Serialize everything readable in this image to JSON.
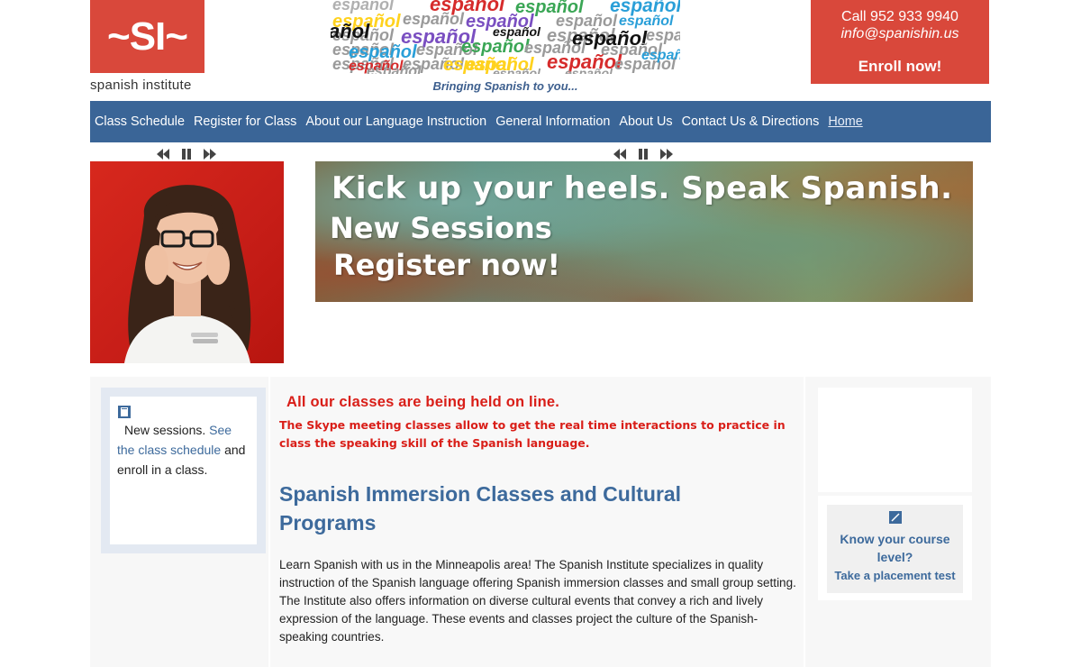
{
  "header": {
    "logo": {
      "mark": "~SI~",
      "name": "spanish institute",
      "color": "#d9483b"
    },
    "collage_words": [
      "español",
      "español",
      "español",
      "español",
      "español",
      "español",
      "español",
      "español",
      "español",
      "español",
      "español",
      "español",
      "español",
      "español",
      "español",
      "español",
      "español",
      "español",
      "español",
      "español",
      "español",
      "español",
      "español",
      "español",
      "español",
      "español",
      "español",
      "español",
      "español",
      "español",
      "español",
      "español",
      "añol"
    ],
    "tagline": "Bringing Spanish to you...",
    "contact": {
      "phone": "Call 952 933 9940",
      "email": "info@spanishin.us",
      "enroll": "Enroll now!",
      "color": "#d9483b"
    }
  },
  "nav": {
    "color": "#3a6597",
    "items": [
      {
        "label": "Class Schedule"
      },
      {
        "label": "Register for Class"
      },
      {
        "label": "About our Language Instruction"
      },
      {
        "label": "General Information"
      },
      {
        "label": "About Us"
      },
      {
        "label": "Contact Us & Directions"
      },
      {
        "label": "Home"
      }
    ]
  },
  "slider_controls": [
    "rewind-icon",
    "pause-icon",
    "fast-forward-icon"
  ],
  "banner": {
    "line1": "Kick up your heels. Speak Spanish.",
    "line2": "New Sessions",
    "line3": "Register now!"
  },
  "sidebar_left": {
    "text_before": "New sessions.",
    "link": "See the class schedule",
    "text_after": "and enroll in a class."
  },
  "main": {
    "alert_title": "All our classes are being held on line.",
    "alert_text": "The Skype meeting classes allow to get the real time interactions to practice in class the speaking skill of the Spanish language.",
    "heading": "Spanish Immersion Classes and Cultural Programs",
    "paragraph": "Learn Spanish with us in the Minneapolis area! The Spanish Institute specializes in quality instruction of the Spanish language offering Spanish immersion classes and small group setting. The Institute also offers information on diverse cultural events that convey a rich and lively expression of the language. These events and classes project the culture of the Spanish-speaking countries."
  },
  "sidebar_right": {
    "placement_title": "Know your course level?",
    "placement_link": "Take a placement test"
  },
  "colors": {
    "accent_red": "#d91e18",
    "link_blue": "#3d6a9c"
  }
}
